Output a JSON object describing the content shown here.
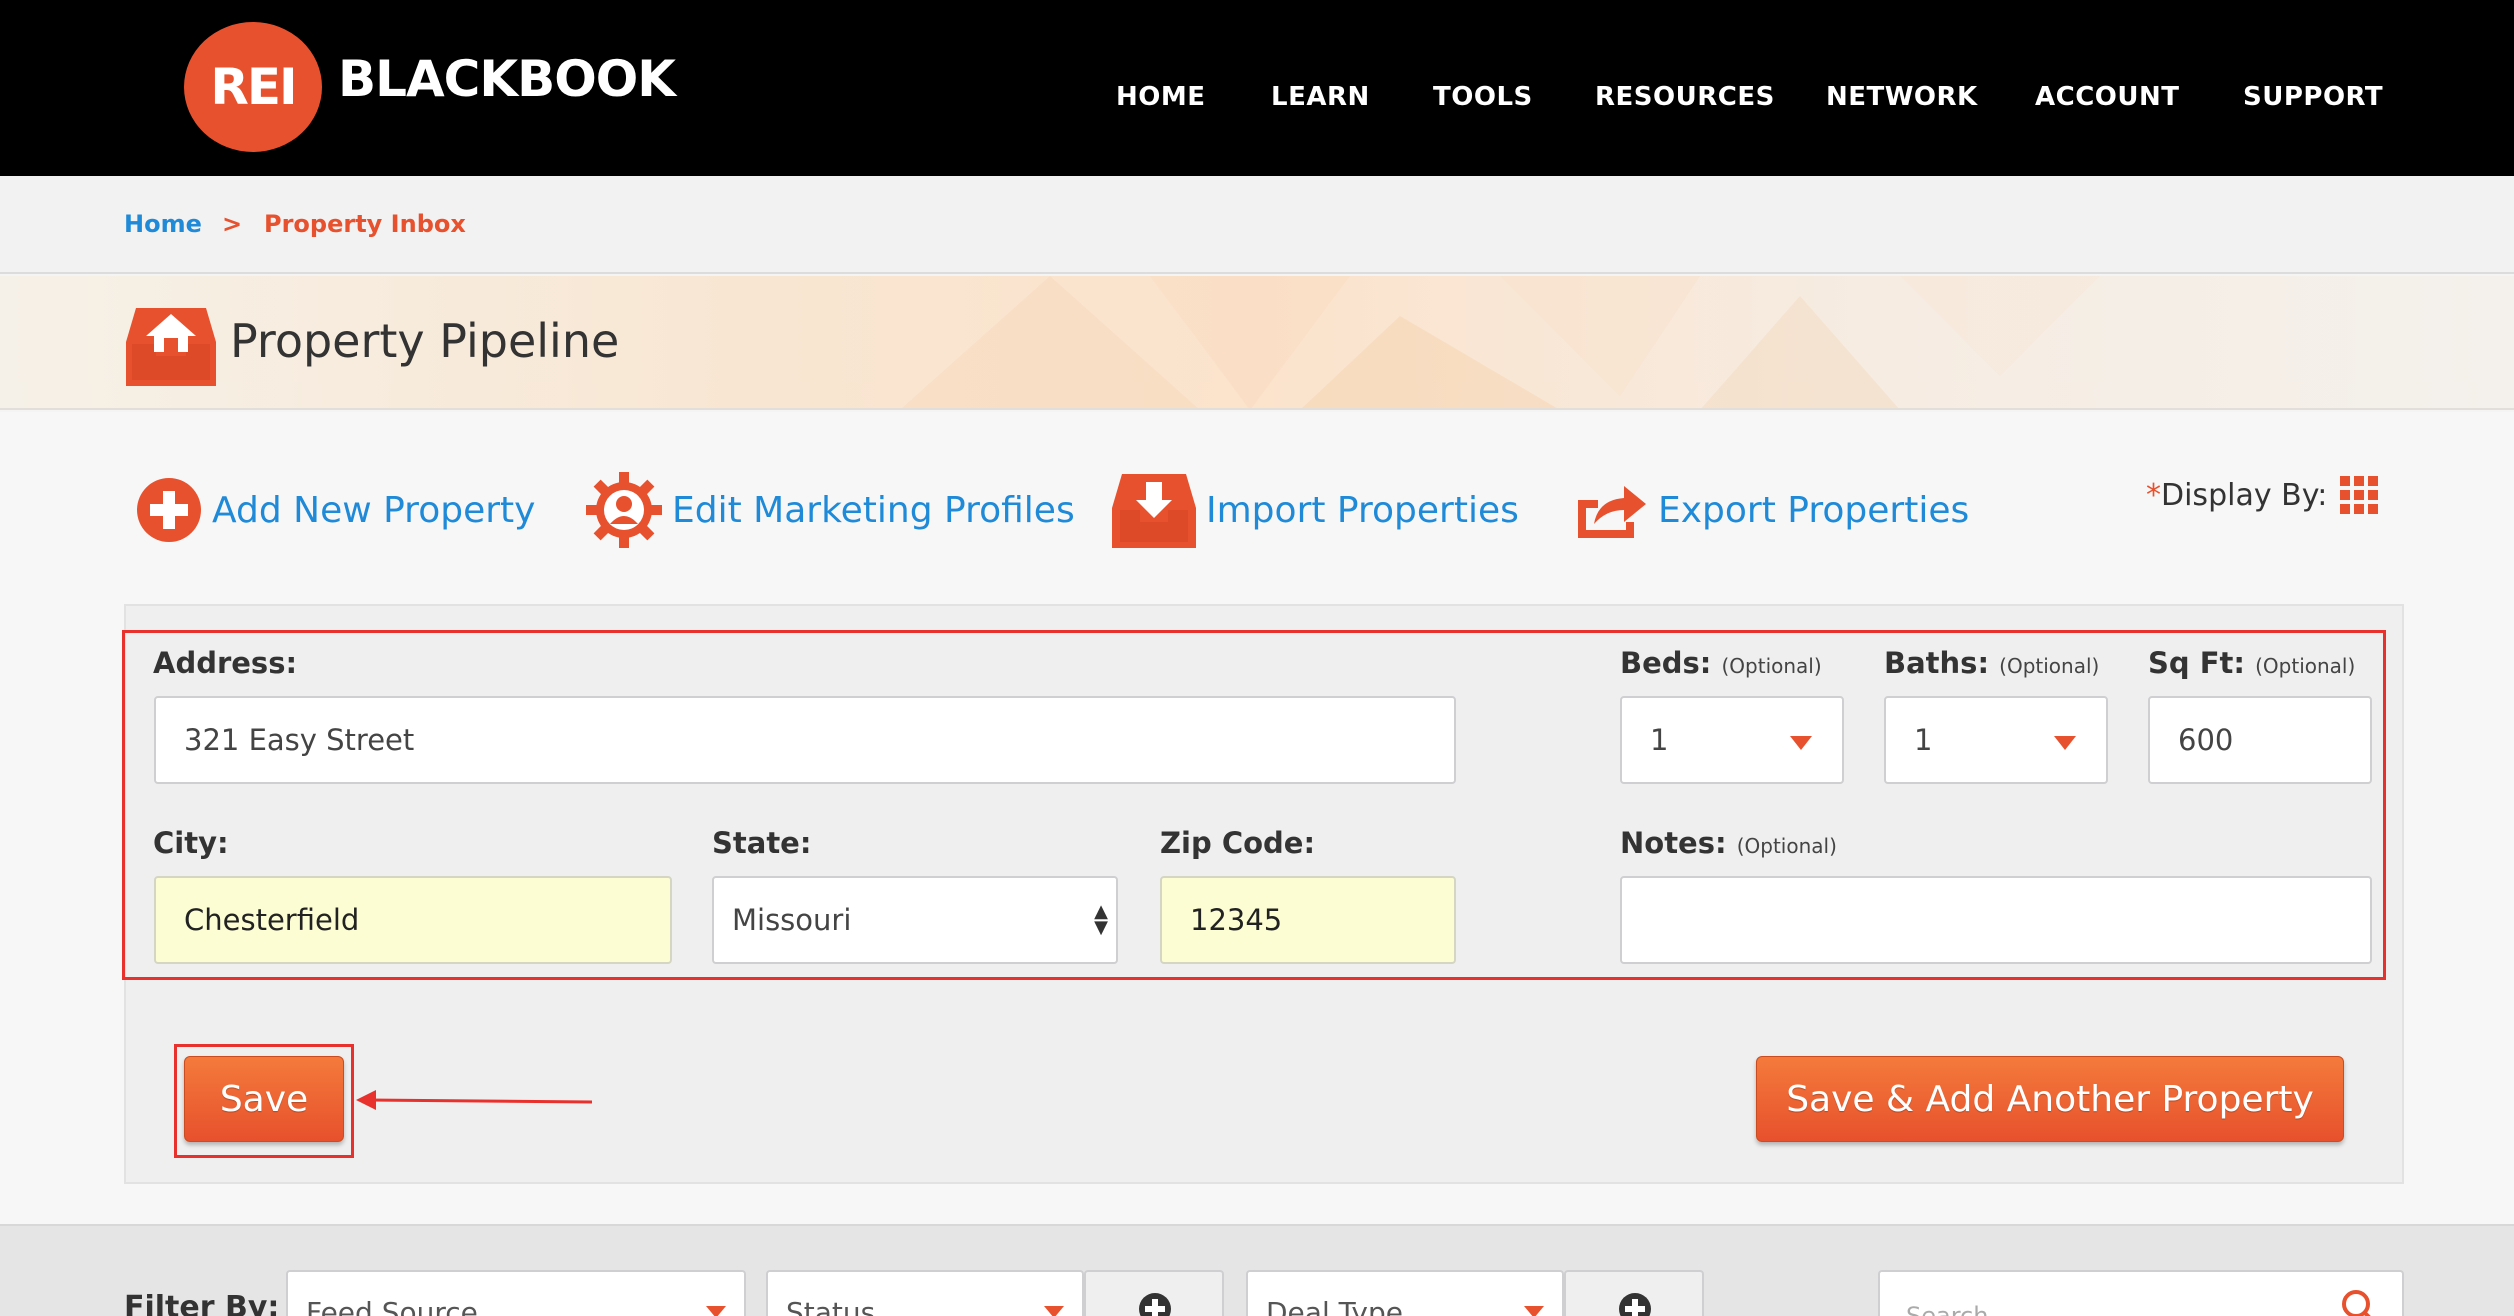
{
  "brand": {
    "badge": "REI",
    "name": "BLACKBOOK",
    "accent": "#e7512d",
    "link": "#1f8ad8"
  },
  "nav": [
    "HOME",
    "LEARN",
    "TOOLS",
    "RESOURCES",
    "NETWORK",
    "ACCOUNT",
    "SUPPORT"
  ],
  "breadcrumb": {
    "home": "Home",
    "separator": ">",
    "current": "Property Inbox"
  },
  "page": {
    "title": "Property Pipeline",
    "icon": "inbox-house-icon"
  },
  "actions": [
    {
      "label": "Add New Property",
      "icon": "plus-circle-icon"
    },
    {
      "label": "Edit Marketing Profiles",
      "icon": "gear-user-icon"
    },
    {
      "label": "Import Properties",
      "icon": "inbox-download-icon"
    },
    {
      "label": "Export Properties",
      "icon": "share-arrow-icon"
    }
  ],
  "display_by": {
    "asterisk": "*",
    "label": "Display By:",
    "icon": "grid-icon"
  },
  "form": {
    "address": {
      "label": "Address:",
      "value": "321 Easy Street"
    },
    "beds": {
      "label": "Beds:",
      "optional": "(Optional)",
      "value": "1"
    },
    "baths": {
      "label": "Baths:",
      "optional": "(Optional)",
      "value": "1"
    },
    "sqft": {
      "label": "Sq Ft:",
      "optional": "(Optional)",
      "value": "600"
    },
    "city": {
      "label": "City:",
      "value": "Chesterfield"
    },
    "state": {
      "label": "State:",
      "value": "Missouri"
    },
    "zip": {
      "label": "Zip Code:",
      "value": "12345"
    },
    "notes": {
      "label": "Notes:",
      "optional": "(Optional)",
      "value": ""
    }
  },
  "buttons": {
    "save": "Save",
    "save_add": "Save & Add Another Property"
  },
  "filter": {
    "label": "Filter By:",
    "feed_source": "Feed Source",
    "status": "Status",
    "deal_type": "Deal Type",
    "search_placeholder": "Search"
  }
}
